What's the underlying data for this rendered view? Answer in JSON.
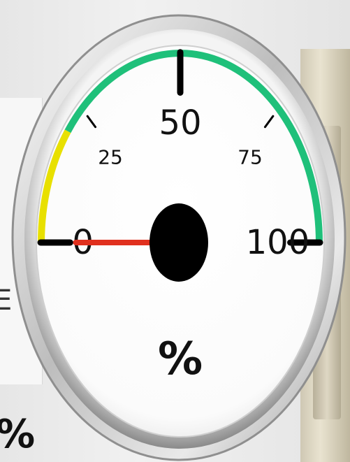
{
  "gauge": {
    "min": 0,
    "max": 100,
    "value": 0,
    "unit_label": "%",
    "ticks": [
      {
        "value": 0,
        "label": "0",
        "major": true
      },
      {
        "value": 25,
        "label": "25",
        "major": false
      },
      {
        "value": 50,
        "label": "50",
        "major": true
      },
      {
        "value": 75,
        "label": "75",
        "major": false
      },
      {
        "value": 100,
        "label": "100",
        "major": true
      }
    ],
    "zones": [
      {
        "from": 0,
        "to": 20,
        "color": "#e8e000"
      },
      {
        "from": 20,
        "to": 100,
        "color": "#1fc07a"
      }
    ],
    "needle_color": "#e0301e",
    "hub_color": "#000000"
  },
  "background": {
    "left_glyph": "E",
    "bottom_left_glyph": "%"
  }
}
